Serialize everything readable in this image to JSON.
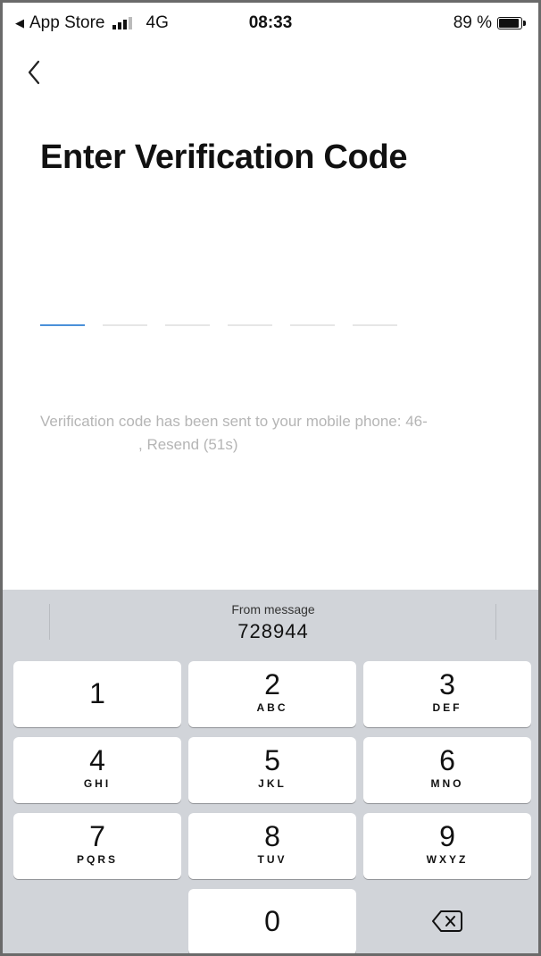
{
  "status_bar": {
    "carrier_back": "App Store",
    "network": "4G",
    "time": "08:33",
    "battery": "89 %",
    "battery_level": 0.89
  },
  "nav": {
    "back_icon": "chevron-left-icon"
  },
  "page": {
    "title": "Enter Verification Code",
    "code_slots": 6,
    "sent_prefix": "Verification code has been sent to your mobile phone: 46-",
    "sent_suffix": ", Resend (51s)"
  },
  "keyboard": {
    "suggestion_label": "From message",
    "suggestion_code": "728944",
    "keys": [
      {
        "digit": "1",
        "letters": ""
      },
      {
        "digit": "2",
        "letters": "ABC"
      },
      {
        "digit": "3",
        "letters": "DEF"
      },
      {
        "digit": "4",
        "letters": "GHI"
      },
      {
        "digit": "5",
        "letters": "JKL"
      },
      {
        "digit": "6",
        "letters": "MNO"
      },
      {
        "digit": "7",
        "letters": "PQRS"
      },
      {
        "digit": "8",
        "letters": "TUV"
      },
      {
        "digit": "9",
        "letters": "WXYZ"
      },
      {
        "digit": "0",
        "letters": ""
      }
    ],
    "delete_icon": "backspace-icon"
  }
}
